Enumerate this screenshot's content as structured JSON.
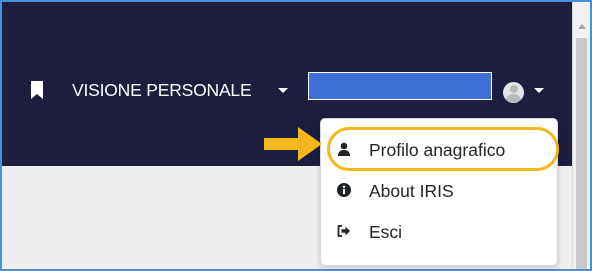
{
  "navbar": {
    "brand_label": "VISIONE PERSONALE",
    "icons": {
      "bookmark": "bookmark-icon",
      "caret": "caret-down-icon",
      "avatar": "user-avatar-icon"
    },
    "user_name": ""
  },
  "dropdown": {
    "items": [
      {
        "label": "Profilo anagrafico",
        "icon": "user-icon",
        "highlighted": true
      },
      {
        "label": "About IRIS",
        "icon": "info-circle-icon"
      },
      {
        "label": "Esci",
        "icon": "sign-out-icon"
      }
    ]
  },
  "colors": {
    "navbar_bg": "#1d1d40",
    "content_bg": "#eeeeee",
    "highlight": "#f3b71c",
    "arrow": "#f3b71c",
    "user_box": "#3f6fd6",
    "frame_border": "#4a90d9"
  }
}
